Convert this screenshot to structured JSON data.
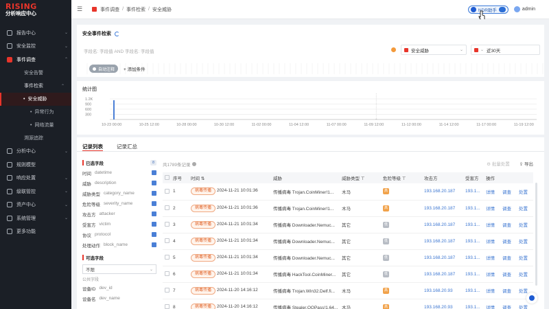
{
  "brand": {
    "logo": "RISING",
    "subtitle": "分析响应中心"
  },
  "sidebar": {
    "items": [
      {
        "label": "报告中心",
        "icon": "report-icon"
      },
      {
        "label": "安全监控",
        "icon": "monitor-icon"
      },
      {
        "label": "事件调查",
        "icon": "investigate-icon"
      },
      {
        "label": "分析中心",
        "icon": "analysis-icon"
      },
      {
        "label": "规则模型",
        "icon": "rule-icon"
      },
      {
        "label": "响应处置",
        "icon": "response-icon"
      },
      {
        "label": "级联管控",
        "icon": "cascade-icon"
      },
      {
        "label": "资产中心",
        "icon": "asset-icon"
      },
      {
        "label": "系统管理",
        "icon": "system-icon"
      },
      {
        "label": "更多功能",
        "icon": "more-icon"
      }
    ],
    "sub": {
      "alerts": "安全告警",
      "event_search": "事件检索",
      "threat": "安全威胁",
      "anomaly": "异常行为",
      "netflow": "网络流量",
      "trace": "溯源追踪"
    }
  },
  "topbar": {
    "breadcrumbs": [
      "事件调查",
      "事件检索",
      "安全威胁"
    ],
    "ndr_label": "NDR助手",
    "user": "admin"
  },
  "search": {
    "title": "安全事件检索",
    "placeholder": "字段名: 字段值 AND 字段名: 字段值",
    "type_select": "安全威胁",
    "time_select": "近30天",
    "auto_tag": "自动注释",
    "add_condition": "添加条件"
  },
  "chart_data": {
    "type": "bar",
    "title": "统计图",
    "y_ticks": [
      "1.2K",
      "900",
      "600",
      "300"
    ],
    "x_ticks": [
      "10-23 00:00",
      "10-25 12:00",
      "10-28 00:00",
      "10-30 12:00",
      "11-02 00:00",
      "11-04 12:00",
      "11-07 00:00",
      "11-09 12:00",
      "11-12 00:00",
      "11-14 12:00",
      "11-17 00:00",
      "11-19 12:00"
    ],
    "ylim": [
      0,
      1200
    ],
    "categories": [
      "10-23",
      "11-09"
    ],
    "values": [
      1050,
      30
    ]
  },
  "list": {
    "tabs": [
      "记录列表",
      "记录汇总"
    ],
    "selected_header": "已选字段",
    "selected_count": "8",
    "selected_fields": [
      {
        "cn": "时间",
        "en": "datetime"
      },
      {
        "cn": "威胁",
        "en": "description"
      },
      {
        "cn": "威胁类型",
        "en": "category_name"
      },
      {
        "cn": "危险等级",
        "en": "severity_name"
      },
      {
        "cn": "攻击方",
        "en": "attacker"
      },
      {
        "cn": "受害方",
        "en": "victim"
      },
      {
        "cn": "协议",
        "en": "protocol"
      },
      {
        "cn": "处理动作",
        "en": "block_name"
      }
    ],
    "optional_header": "可选字段",
    "optional_select": "不限",
    "public_header": "公共字段",
    "public_fields": [
      {
        "cn": "设备ID",
        "en": "dev_id"
      },
      {
        "cn": "设备名",
        "en": "dev_name"
      }
    ],
    "total": "共1789条记录",
    "batch_action": "批量处置",
    "export": "导出",
    "columns": [
      "序号",
      "时间",
      "威胁",
      "威胁类型",
      "危险等级",
      "攻击方",
      "受害方",
      "操作"
    ],
    "rows": [
      {
        "no": "1",
        "tag": "病毒传播",
        "time": "2024-11-21 10:01:36",
        "threat": "传播病毒 Trojan.CoinMiner!1...",
        "type": "木马",
        "level": "高",
        "lvclass": "high",
        "attacker": "193.168.20.187",
        "victim": "193.1..."
      },
      {
        "no": "2",
        "tag": "病毒传播",
        "time": "2024-11-21 10:01:36",
        "threat": "传播病毒 Trojan.CoinMiner!1...",
        "type": "木马",
        "level": "高",
        "lvclass": "high",
        "attacker": "193.168.20.187",
        "victim": "193.1..."
      },
      {
        "no": "3",
        "tag": "病毒传播",
        "time": "2024-11-21 10:01:34",
        "threat": "传播病毒 Downloader.Nemuc...",
        "type": "其它",
        "level": "低",
        "lvclass": "low",
        "attacker": "193.168.20.187",
        "victim": "193.1..."
      },
      {
        "no": "4",
        "tag": "病毒传播",
        "time": "2024-11-21 10:01:34",
        "threat": "传播病毒 Downloader.Nemuc...",
        "type": "其它",
        "level": "低",
        "lvclass": "low",
        "attacker": "193.168.20.187",
        "victim": "193.1..."
      },
      {
        "no": "5",
        "tag": "病毒传播",
        "time": "2024-11-21 10:01:34",
        "threat": "传播病毒 Downloader.Nemuc...",
        "type": "其它",
        "level": "低",
        "lvclass": "low",
        "attacker": "193.168.20.187",
        "victim": "193.1..."
      },
      {
        "no": "6",
        "tag": "病毒传播",
        "time": "2024-11-21 10:01:34",
        "threat": "传播病毒 HackTool.CoinMiner...",
        "type": "其它",
        "level": "低",
        "lvclass": "low",
        "attacker": "193.168.20.187",
        "victim": "193.1..."
      },
      {
        "no": "7",
        "tag": "病毒传播",
        "time": "2024-11-20 14:16:12",
        "threat": "传播病毒 Trojan.Win32.Delf.fi...",
        "type": "木马",
        "level": "高",
        "lvclass": "high",
        "attacker": "193.168.20.93",
        "victim": "193.1..."
      },
      {
        "no": "8",
        "tag": "病毒传播",
        "time": "2024-11-20 14:16:12",
        "threat": "传播病毒 Stealer.QQPass!1.64...",
        "type": "木马",
        "level": "高",
        "lvclass": "high",
        "attacker": "193.168.20.93",
        "victim": "193.1..."
      }
    ],
    "op_labels": [
      "详情",
      "调查",
      "处置"
    ]
  }
}
